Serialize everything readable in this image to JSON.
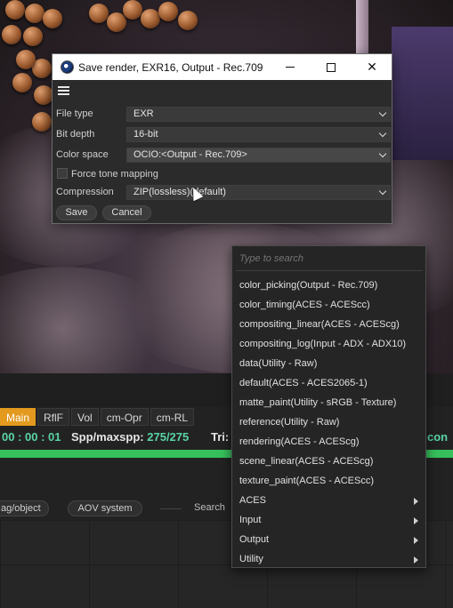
{
  "dialog": {
    "title": "Save render, EXR16, Output - Rec.709",
    "window_controls": {
      "minimize_icon": "minimize-icon",
      "maximize_icon": "maximize-icon",
      "close_icon": "close-icon",
      "close_symbol": "✕"
    },
    "menu_icon": "hamburger-menu-icon",
    "fields": {
      "file_type": {
        "label": "File type",
        "value": "EXR"
      },
      "bit_depth": {
        "label": "Bit depth",
        "value": "16-bit"
      },
      "color_space": {
        "label": "Color space",
        "value": "OCIO:<Output - Rec.709>"
      },
      "force_tone_mapping": {
        "label": "Force tone mapping",
        "checked": false
      },
      "compression": {
        "label": "Compression",
        "value": "ZIP(lossless)(default)"
      }
    },
    "buttons": {
      "save": "Save",
      "cancel": "Cancel"
    }
  },
  "color_space_popup": {
    "search_placeholder": "Type to search",
    "items": [
      {
        "label": "color_picking(Output - Rec.709)",
        "submenu": false
      },
      {
        "label": "color_timing(ACES - ACEScc)",
        "submenu": false
      },
      {
        "label": "compositing_linear(ACES - ACEScg)",
        "submenu": false
      },
      {
        "label": "compositing_log(Input - ADX - ADX10)",
        "submenu": false
      },
      {
        "label": "data(Utility - Raw)",
        "submenu": false
      },
      {
        "label": "default(ACES - ACES2065-1)",
        "submenu": false
      },
      {
        "label": "matte_paint(Utility - sRGB - Texture)",
        "submenu": false
      },
      {
        "label": "reference(Utility - Raw)",
        "submenu": false
      },
      {
        "label": "rendering(ACES - ACEScg)",
        "submenu": false
      },
      {
        "label": "scene_linear(ACES - ACEScg)",
        "submenu": false
      },
      {
        "label": "texture_paint(ACES - ACEScc)",
        "submenu": false
      },
      {
        "label": "ACES",
        "submenu": true
      },
      {
        "label": "Input",
        "submenu": true
      },
      {
        "label": "Output",
        "submenu": true
      },
      {
        "label": "Utility",
        "submenu": true
      }
    ]
  },
  "render_panel": {
    "tabs": [
      "Main",
      "RflF",
      "Vol",
      "cm-Opr",
      "cm-RL"
    ],
    "active_tab": "Main",
    "status": {
      "time": "00 : 00 : 01",
      "spp_label": "Spp/maxspp:",
      "spp_value": "275/275",
      "tri_label": "Tri:",
      "trailing": "con"
    },
    "progress": 1.0,
    "progress_color": "#36c05c",
    "toolbar": {
      "tag_object": "ag/object",
      "aov_system": "AOV system",
      "search": "Search"
    }
  },
  "colors": {
    "accent_tab": "#e39a1e",
    "status_green": "#5ad4a6",
    "progress_green": "#36c05c"
  }
}
